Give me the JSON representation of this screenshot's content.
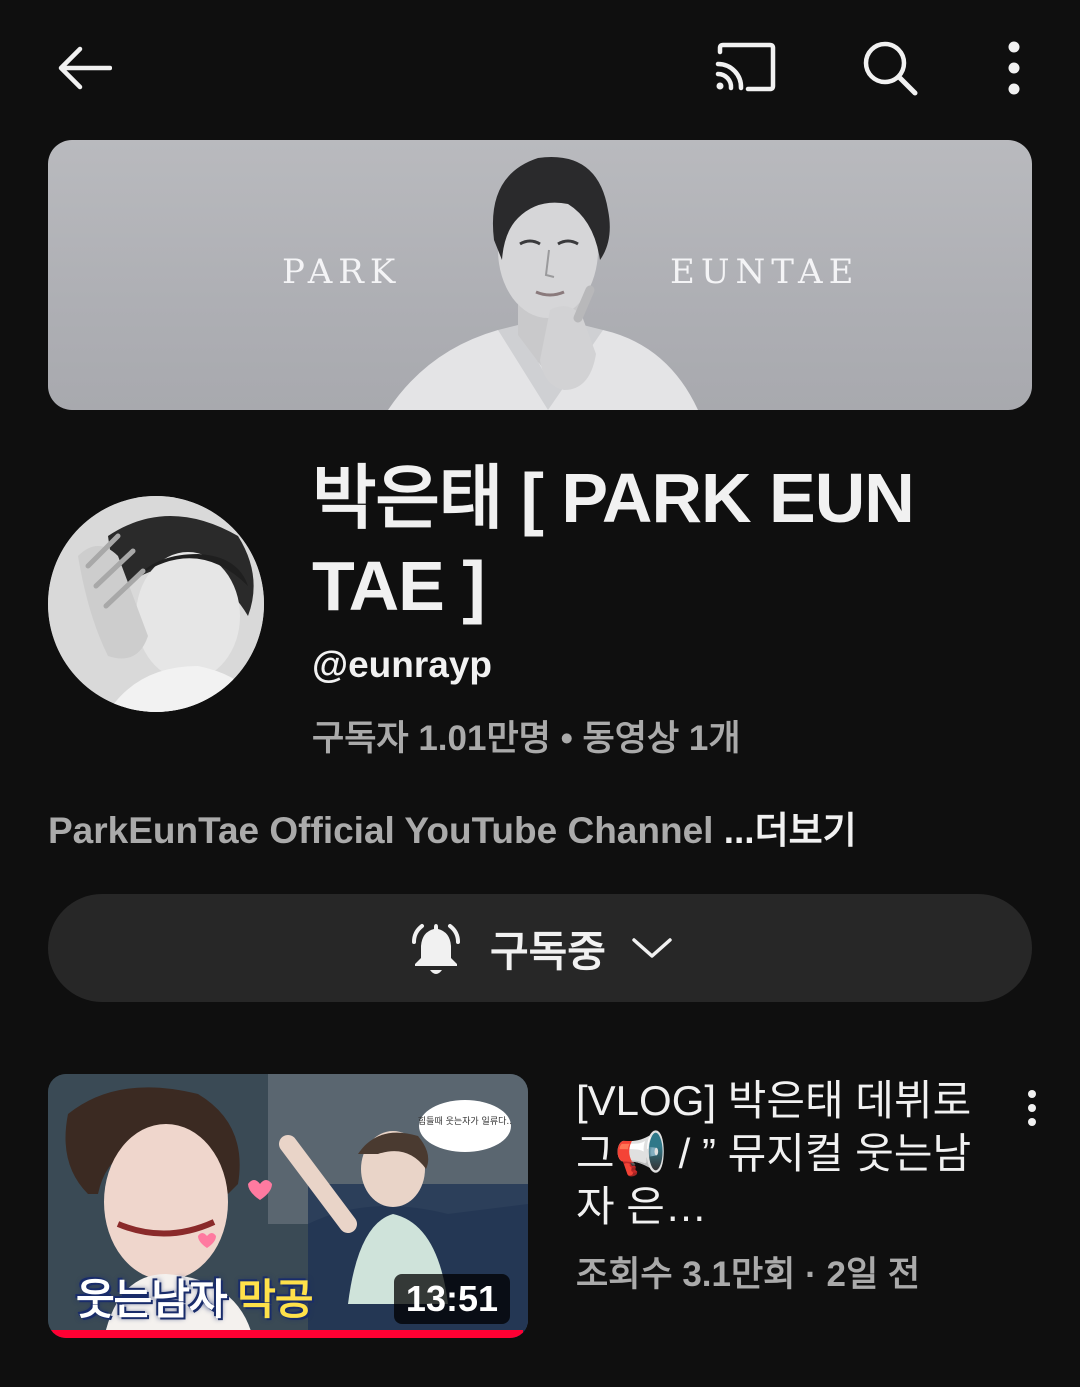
{
  "topbar": {
    "icons": [
      "back-arrow-icon",
      "cast-icon",
      "search-icon",
      "more-vert-icon"
    ]
  },
  "banner": {
    "word_left": "PARK",
    "word_right": "EUNTAE"
  },
  "channel": {
    "title": "박은태 [ PARK EUN TAE ]",
    "handle": "@eunrayp",
    "stats": "구독자 1.01만명 • 동영상 1개",
    "description": "ParkEunTae Official YouTube Channel ",
    "more_label": "...더보기"
  },
  "subscribe": {
    "label": "구독중",
    "icons": [
      "bell-ringing-icon",
      "chevron-down-icon"
    ]
  },
  "video": {
    "title": "[VLOG] 박은태 데뷔로그📢 / ” 뮤지컬 웃는남자 은…",
    "meta": "조회수 3.1만회 · 2일 전",
    "duration": "13:51",
    "thumb_caption_main": "웃는남자 ",
    "thumb_caption_accent": "막공",
    "thumb_bubble": "힘들때 웃는자가 일류다..",
    "watched_fraction": 0.99
  },
  "colors": {
    "background": "#0f0f0f",
    "button_bg": "#272727",
    "secondary_text": "#aaaaaa",
    "progress_red": "#ff0033"
  }
}
